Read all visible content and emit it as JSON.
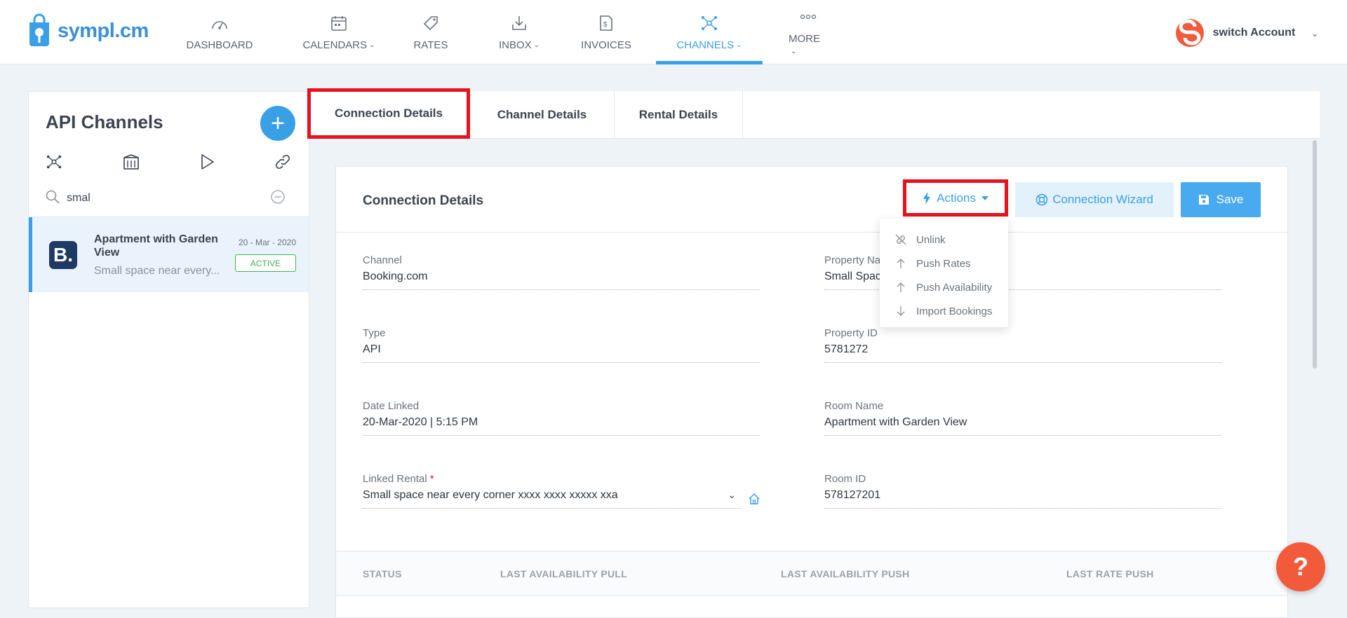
{
  "brand": {
    "name": "sympl.cm"
  },
  "nav": {
    "items": [
      {
        "label": "DASHBOARD",
        "icon": "speedometer-icon"
      },
      {
        "label": "CALENDARS",
        "icon": "calendar-icon"
      },
      {
        "label": "RATES",
        "icon": "price-tag-icon"
      },
      {
        "label": "INBOX",
        "icon": "inbox-download-icon"
      },
      {
        "label": "INVOICES",
        "icon": "invoice-icon"
      },
      {
        "label": "CHANNELS",
        "icon": "network-icon"
      },
      {
        "label": "MORE",
        "icon": "dots-icon"
      }
    ]
  },
  "account": {
    "label": "switch Account"
  },
  "sidebar": {
    "title": "API Channels",
    "search": {
      "value": "smal"
    },
    "channel": {
      "logo_letter": "B.",
      "title": "Apartment with Garden View",
      "subtitle": "Small space near every...",
      "date": "20 - Mar - 2020",
      "status": "ACTIVE"
    }
  },
  "tabs": [
    "Connection Details",
    "Channel Details",
    "Rental Details"
  ],
  "card": {
    "title": "Connection Details",
    "actions_label": "Actions",
    "wizard_label": "Connection Wizard",
    "save_label": "Save"
  },
  "fields": {
    "channel": {
      "label": "Channel",
      "value": "Booking.com"
    },
    "property_name": {
      "label": "Property Na",
      "value": "Small Spac"
    },
    "type": {
      "label": "Type",
      "value": "API"
    },
    "property_id": {
      "label": "Property ID",
      "value": "5781272"
    },
    "date_linked": {
      "label": "Date Linked",
      "value": "20-Mar-2020 | 5:15 PM"
    },
    "room_name": {
      "label": "Room Name",
      "value": "Apartment with Garden View"
    },
    "linked_rental": {
      "label": "Linked Rental",
      "required": "*",
      "value": "Small space near every corner xxxx xxxx xxxxx xxa"
    },
    "room_id": {
      "label": "Room ID",
      "value": "578127201"
    }
  },
  "status_headers": [
    "STATUS",
    "LAST AVAILABILITY PULL",
    "LAST AVAILABILITY PUSH",
    "LAST RATE PUSH"
  ],
  "actions_menu": [
    {
      "label": "Unlink",
      "icon": "unlink-icon"
    },
    {
      "label": "Push Rates",
      "icon": "arrow-up-icon"
    },
    {
      "label": "Push Availability",
      "icon": "arrow-up-icon"
    },
    {
      "label": "Import Bookings",
      "icon": "arrow-down-icon"
    }
  ],
  "help": {
    "label": "?"
  },
  "colors": {
    "accent": "#3aa0e6",
    "highlight": "#e8121f",
    "active_badge": "#3fb64a",
    "help": "#f15a3a"
  }
}
